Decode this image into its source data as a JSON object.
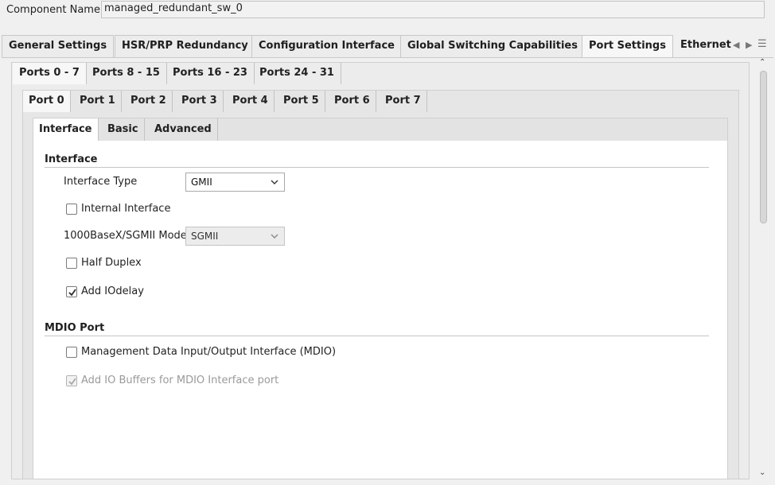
{
  "component": {
    "label": "Component Name",
    "value": "managed_redundant_sw_0"
  },
  "top_tabs": [
    {
      "label": "General Settings"
    },
    {
      "label": "HSR/PRP Redundancy"
    },
    {
      "label": "Configuration Interface"
    },
    {
      "label": "Global Switching Capabilities"
    },
    {
      "label": "Port Settings",
      "active": true
    },
    {
      "label": "Ethernet"
    }
  ],
  "port_group_tabs": [
    {
      "label": "Ports 0 - 7",
      "active": true
    },
    {
      "label": "Ports 8 - 15"
    },
    {
      "label": "Ports 16 - 23"
    },
    {
      "label": "Ports 24 - 31"
    }
  ],
  "port_tabs": [
    {
      "label": "Port 0",
      "active": true
    },
    {
      "label": "Port 1"
    },
    {
      "label": "Port 2"
    },
    {
      "label": "Port 3"
    },
    {
      "label": "Port 4"
    },
    {
      "label": "Port 5"
    },
    {
      "label": "Port 6"
    },
    {
      "label": "Port 7"
    }
  ],
  "detail_tabs": [
    {
      "label": "Interface",
      "active": true
    },
    {
      "label": "Basic"
    },
    {
      "label": "Advanced"
    }
  ],
  "interface_section": {
    "title": "Interface",
    "interface_type": {
      "label": "Interface Type",
      "value": "GMII"
    },
    "internal_interface": {
      "label": "Internal Interface",
      "checked": false
    },
    "mode": {
      "label": "1000BaseX/SGMII Mode",
      "value": "SGMII",
      "disabled": true
    },
    "half_duplex": {
      "label": "Half Duplex",
      "checked": false
    },
    "add_iodelay": {
      "label": "Add IOdelay",
      "checked": true
    }
  },
  "mdio_section": {
    "title": "MDIO Port",
    "mdio": {
      "label": "Management Data Input/Output Interface (MDIO)",
      "checked": false
    },
    "io_buffers": {
      "label": "Add IO Buffers for MDIO Interface port",
      "checked": true,
      "disabled": true
    }
  }
}
